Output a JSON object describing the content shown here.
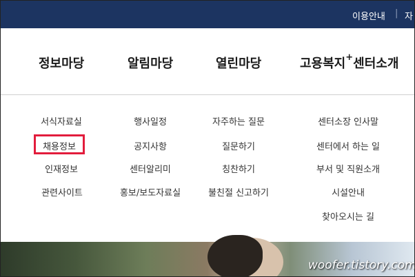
{
  "topbar": {
    "usage_label": "이용안내",
    "separator": "|",
    "next_label_partial": "자"
  },
  "gnb": {
    "menus": [
      {
        "label": "정보마당"
      },
      {
        "label": "알림마당"
      },
      {
        "label": "열린마당"
      },
      {
        "label_prefix": "고용복지",
        "label_sup": "+",
        "label_suffix": "센터소개"
      }
    ]
  },
  "submenu": {
    "columns": [
      {
        "items": [
          "서식자료실",
          "채용정보",
          "인재정보",
          "관련사이트"
        ]
      },
      {
        "items": [
          "행사일정",
          "공지사항",
          "센터알리미",
          "홍보/보도자료실"
        ]
      },
      {
        "items": [
          "자주하는 질문",
          "질문하기",
          "칭찬하기",
          "불친절 신고하기"
        ]
      },
      {
        "items": [
          "센터소장 인사말",
          "센터에서 하는 일",
          "부서 및 직원소개",
          "시설안내",
          "찾아오시는 길"
        ]
      }
    ],
    "highlighted_item": "채용정보",
    "highlight_color": "#e21c3c"
  },
  "colors": {
    "topbar_bg": "#1c3461"
  },
  "watermark": "woofer.tistory.com"
}
